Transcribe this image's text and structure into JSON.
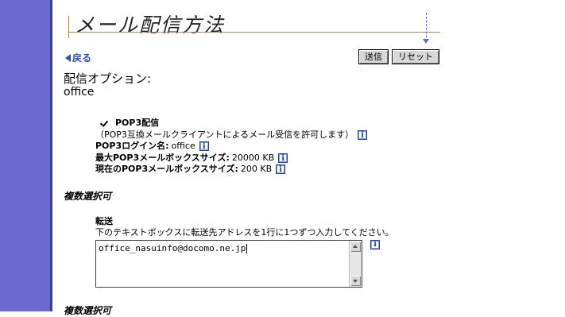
{
  "page": {
    "title": "メール配信方法",
    "back_label": "戻る",
    "send_label": "送信",
    "reset_label": "リセット"
  },
  "options": {
    "heading": "配信オプション:",
    "account": "office"
  },
  "pop3": {
    "checked": true,
    "label": "POP3配信",
    "description": "（POP3互換メールクライアントによるメール受信を許可します）",
    "login_label": "POP3ログイン名:",
    "login_value": "office",
    "max_label": "最大POP3メールボックスサイズ:",
    "max_value": "20000 KB",
    "current_label": "現在のPOP3メールボックスサイズ:",
    "current_value": "200 KB"
  },
  "multi_select_label": "複数選択可",
  "forward": {
    "label": "転送",
    "instructions": "下のテキストボックスに転送先アドレスを1行に1つずつ入力してください。",
    "addresses": "office_nasuinfo@docomo.ne.jp"
  },
  "multi_select_label_2": "複数選択可",
  "colors": {
    "sidebar": "#6b6bcf",
    "link": "#2c4fb6",
    "title_rule": "#a28a52"
  },
  "icons": [
    "back-arrow-icon",
    "checkbox-checked-icon",
    "info-icon",
    "scroll-up-icon",
    "scroll-down-icon"
  ]
}
